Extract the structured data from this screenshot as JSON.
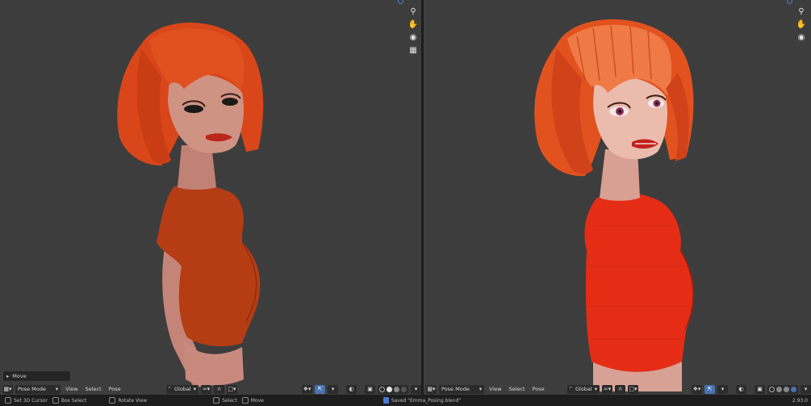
{
  "viewport_left": {
    "header": {
      "editor_icon": "3d-viewport-icon",
      "mode": "Pose Mode",
      "menus": [
        "View",
        "Select",
        "Pose"
      ],
      "orientation": "Global"
    },
    "operator_panel": {
      "label": "Move"
    }
  },
  "viewport_right": {
    "header": {
      "editor_icon": "3d-viewport-icon",
      "mode": "Pose Mode",
      "menus": [
        "View",
        "Select",
        "Pose"
      ],
      "orientation": "Global"
    }
  },
  "status_bar": {
    "left_actions": [
      "Set 3D Cursor",
      "Box Select",
      "Rotate View"
    ],
    "mid_actions": [
      "Select",
      "Move"
    ],
    "message": "Saved \"Emma_Posing.blend\"",
    "version": "2.93.0"
  },
  "colors": {
    "viewport_bg": "#3d3d3d",
    "hair": "#d9461a",
    "hair_highlight": "#f07a45",
    "skin": "#c98a7e",
    "shirt_solid": "#b63c14",
    "shirt_render": "#e52d16",
    "accent": "#4772b3"
  }
}
